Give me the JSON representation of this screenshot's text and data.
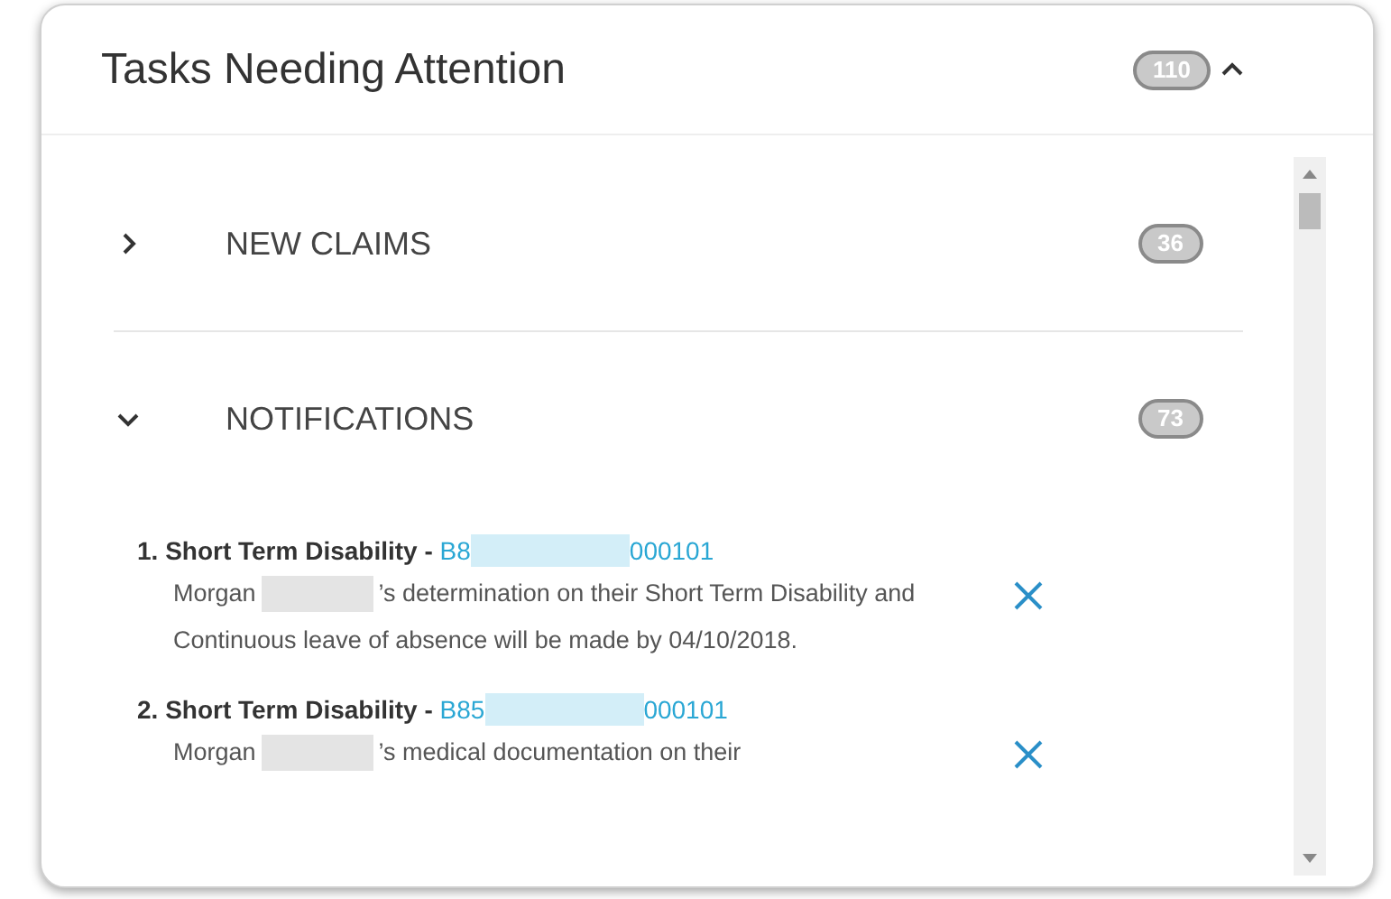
{
  "card": {
    "title": "Tasks Needing Attention",
    "count": "110",
    "expanded": true
  },
  "sections": [
    {
      "label": "NEW CLAIMS",
      "count": "36",
      "expanded": false
    },
    {
      "label": "NOTIFICATIONS",
      "count": "73",
      "expanded": true,
      "items": [
        {
          "number": "1.",
          "title": "Short Term Disability - ",
          "id_start": "B8",
          "id_end": "000101",
          "name": "Morgan",
          "text": "’s determination on their Short Term Disability and Continuous leave of absence will be made by 04/10/2018."
        },
        {
          "number": "2.",
          "title": "Short Term Disability - ",
          "id_start": "B85",
          "id_end": "000101",
          "name": "Morgan",
          "text": "’s medical documentation on their"
        }
      ]
    }
  ]
}
